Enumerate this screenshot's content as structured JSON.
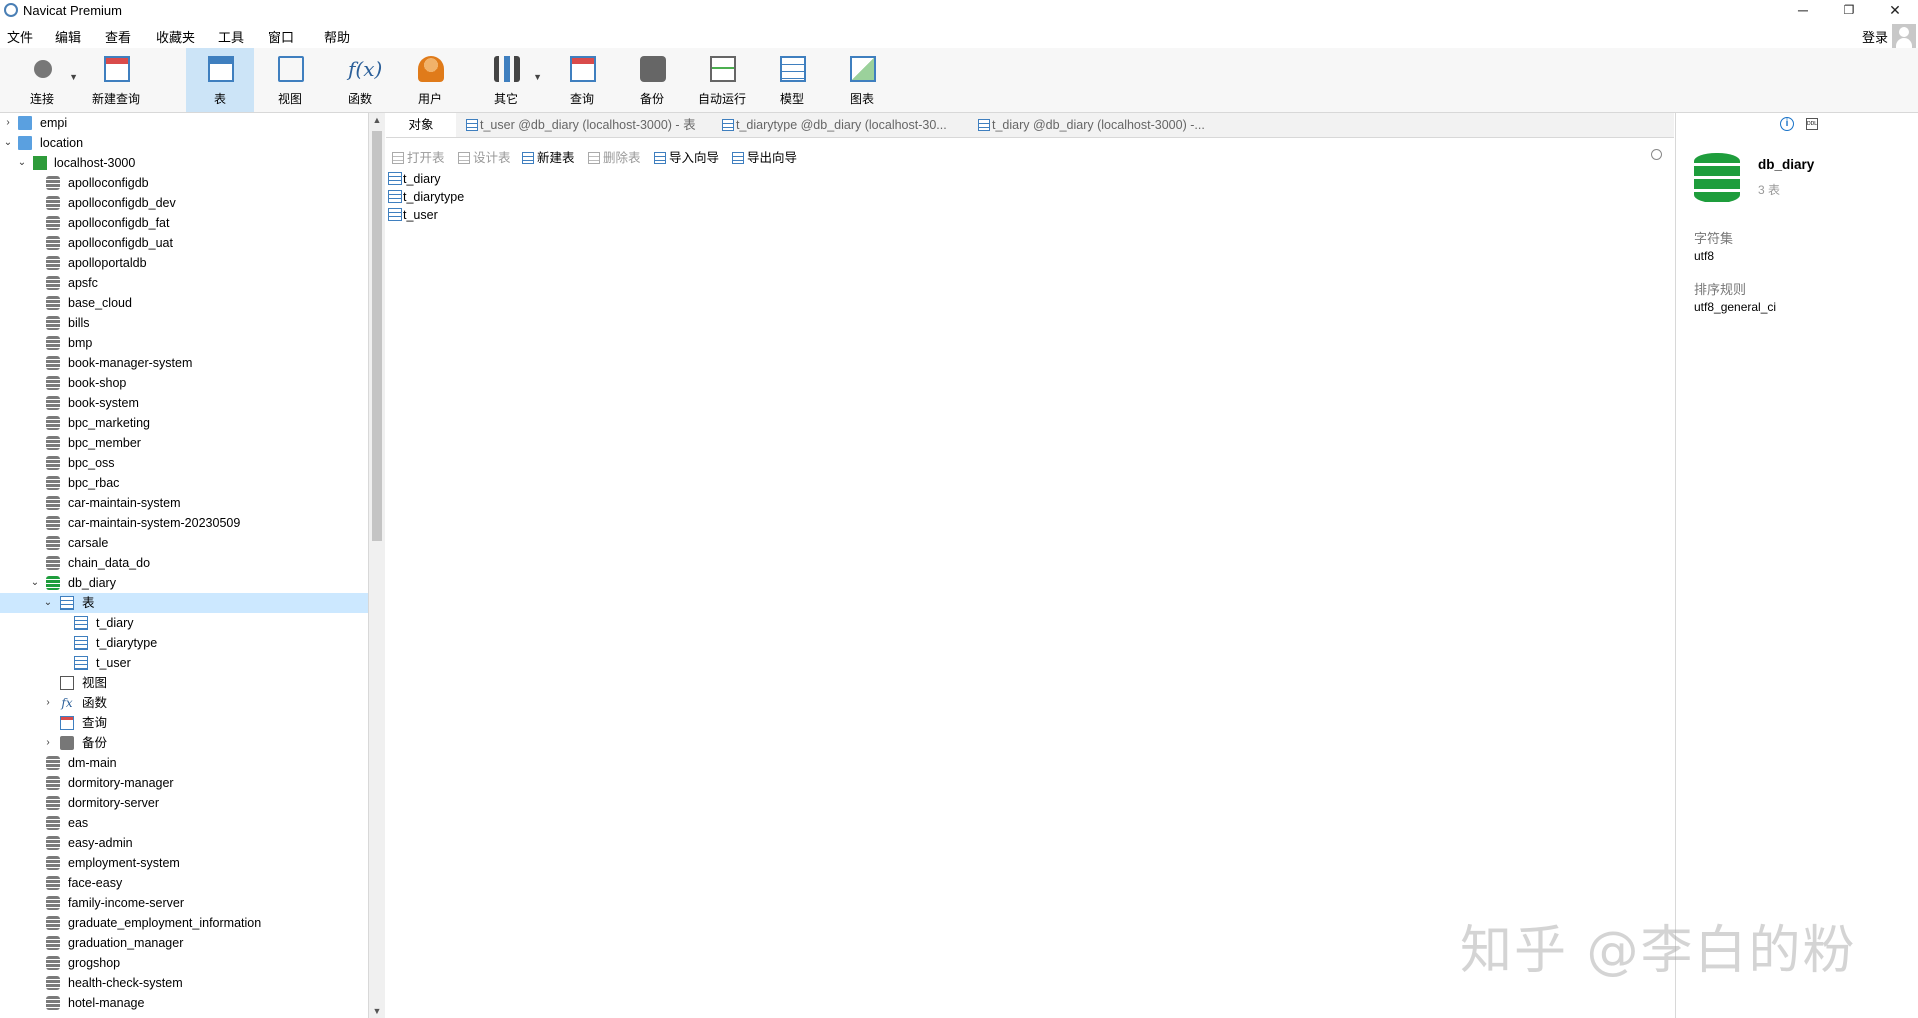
{
  "window": {
    "title": "Navicat Premium"
  },
  "menubar": {
    "items": [
      "文件",
      "编辑",
      "查看",
      "收藏夹",
      "工具",
      "窗口",
      "帮助"
    ],
    "login": "登录"
  },
  "toolbar": {
    "items": [
      {
        "label": "连接",
        "icon": "plug-icon"
      },
      {
        "label": "新建查询",
        "icon": "new-query-icon"
      },
      {
        "label": "表",
        "icon": "table-icon",
        "active": true
      },
      {
        "label": "视图",
        "icon": "view-icon"
      },
      {
        "label": "函数",
        "icon": "function-icon"
      },
      {
        "label": "用户",
        "icon": "user-icon"
      },
      {
        "label": "其它",
        "icon": "tools-icon"
      },
      {
        "label": "查询",
        "icon": "query-icon"
      },
      {
        "label": "备份",
        "icon": "backup-icon"
      },
      {
        "label": "自动运行",
        "icon": "auto-run-icon"
      },
      {
        "label": "模型",
        "icon": "model-icon"
      },
      {
        "label": "图表",
        "icon": "chart-icon"
      }
    ]
  },
  "tree": {
    "items": [
      "empi",
      "location",
      "localhost-3000",
      "apolloconfigdb",
      "apolloconfigdb_dev",
      "apolloconfigdb_fat",
      "apolloconfigdb_uat",
      "apolloportaldb",
      "apsfc",
      "base_cloud",
      "bills",
      "bmp",
      "book-manager-system",
      "book-shop",
      "book-system",
      "bpc_marketing",
      "bpc_member",
      "bpc_oss",
      "bpc_rbac",
      "car-maintain-system",
      "car-maintain-system-20230509",
      "carsale",
      "chain_data_do",
      "db_diary",
      "表",
      "t_diary",
      "t_diarytype",
      "t_user",
      "视图",
      "函数",
      "查询",
      "备份",
      "dm-main",
      "dormitory-manager",
      "dormitory-server",
      "eas",
      "easy-admin",
      "employment-system",
      "face-easy",
      "family-income-server",
      "graduate_employment_information",
      "graduation_manager",
      "grogshop",
      "health-check-system",
      "hotel-manage"
    ]
  },
  "tabs": [
    "对象",
    "t_user @db_diary (localhost-3000) - 表",
    "t_diarytype @db_diary (localhost-30...",
    "t_diary @db_diary (localhost-3000) -..."
  ],
  "objbar": {
    "open": "打开表",
    "design": "设计表",
    "new": "新建表",
    "delete": "删除表",
    "import": "导入向导",
    "export": "导出向导"
  },
  "objects": [
    "t_diary",
    "t_diarytype",
    "t_user"
  ],
  "rpanel": {
    "name": "db_diary",
    "count": "3 表",
    "charset_label": "字符集",
    "charset": "utf8",
    "collation_label": "排序规则",
    "collation": "utf8_general_ci"
  },
  "watermark": "知乎 @李白的粉"
}
